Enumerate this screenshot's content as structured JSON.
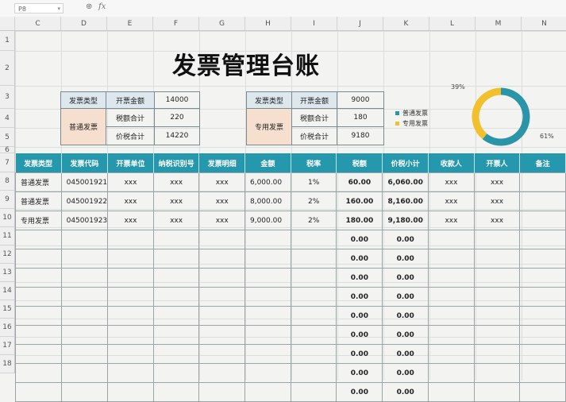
{
  "formula_bar": {
    "name_box": "P8",
    "fx": "fx",
    "zoom_glyph": "⊕"
  },
  "columns": [
    "C",
    "D",
    "E",
    "F",
    "G",
    "H",
    "I",
    "J",
    "K",
    "L",
    "M",
    "N"
  ],
  "rows": [
    "1",
    "2",
    "3",
    "4",
    "5",
    "6",
    "7",
    "8",
    "9",
    "10",
    "11",
    "12",
    "13",
    "14",
    "15",
    "16",
    "17",
    "18"
  ],
  "title": "发票管理台账",
  "summary_left": {
    "type_header": "发票类型",
    "amount_header": "开票金额",
    "amount_value": "14000",
    "type_value": "普通发票",
    "tax_label": "税额合计",
    "tax_value": "220",
    "total_label": "价税合计",
    "total_value": "14220"
  },
  "summary_right": {
    "type_header": "发票类型",
    "amount_header": "开票金额",
    "amount_value": "9000",
    "type_value": "专用发票",
    "tax_label": "税额合计",
    "tax_value": "180",
    "total_label": "价税合计",
    "total_value": "9180"
  },
  "chart_data": {
    "type": "pie",
    "categories": [
      "普通发票",
      "专用发票"
    ],
    "values": [
      61,
      39
    ],
    "labels": [
      "61%",
      "39%"
    ],
    "colors": [
      "#2a95a8",
      "#f1c02c"
    ],
    "legend": "right"
  },
  "table": {
    "headers": [
      "发票类型",
      "发票代码",
      "开票单位",
      "纳税识别号",
      "发票明细",
      "金额",
      "税率",
      "税额",
      "价税小计",
      "收款人",
      "开票人",
      "备注"
    ],
    "rows": [
      [
        "普通发票",
        "045001921",
        "xxx",
        "xxx",
        "xxx",
        "6,000.00",
        "1%",
        "60.00",
        "6,060.00",
        "xxx",
        "xxx",
        ""
      ],
      [
        "普通发票",
        "045001922",
        "xxx",
        "xxx",
        "xxx",
        "8,000.00",
        "2%",
        "160.00",
        "8,160.00",
        "xxx",
        "xxx",
        ""
      ],
      [
        "专用发票",
        "045001923",
        "xxx",
        "xxx",
        "xxx",
        "9,000.00",
        "2%",
        "180.00",
        "9,180.00",
        "xxx",
        "xxx",
        ""
      ],
      [
        "",
        "",
        "",
        "",
        "",
        "",
        "",
        "0.00",
        "0.00",
        "",
        "",
        ""
      ],
      [
        "",
        "",
        "",
        "",
        "",
        "",
        "",
        "0.00",
        "0.00",
        "",
        "",
        ""
      ],
      [
        "",
        "",
        "",
        "",
        "",
        "",
        "",
        "0.00",
        "0.00",
        "",
        "",
        ""
      ],
      [
        "",
        "",
        "",
        "",
        "",
        "",
        "",
        "0.00",
        "0.00",
        "",
        "",
        ""
      ],
      [
        "",
        "",
        "",
        "",
        "",
        "",
        "",
        "0.00",
        "0.00",
        "",
        "",
        ""
      ],
      [
        "",
        "",
        "",
        "",
        "",
        "",
        "",
        "0.00",
        "0.00",
        "",
        "",
        ""
      ],
      [
        "",
        "",
        "",
        "",
        "",
        "",
        "",
        "0.00",
        "0.00",
        "",
        "",
        ""
      ],
      [
        "",
        "",
        "",
        "",
        "",
        "",
        "",
        "0.00",
        "0.00",
        "",
        "",
        ""
      ],
      [
        "",
        "",
        "",
        "",
        "",
        "",
        "",
        "0.00",
        "0.00",
        "",
        "",
        ""
      ]
    ]
  }
}
